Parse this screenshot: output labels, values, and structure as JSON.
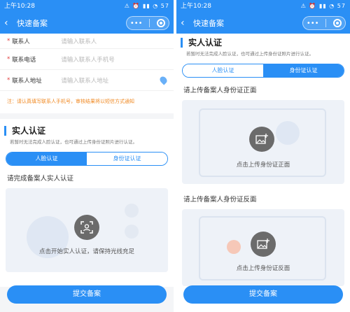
{
  "status": {
    "time": "上午10:28",
    "icons": "⚠ ⏰ ▮▮ ◔ 57"
  },
  "header": {
    "title": "快速备案",
    "capsule_dots": "•••"
  },
  "left": {
    "fields": [
      {
        "label": "联系人",
        "placeholder": "请输入联系人"
      },
      {
        "label": "联系电话",
        "placeholder": "请输入联系人手机号"
      },
      {
        "label": "联系人地址",
        "placeholder": "请输入联系人地址"
      }
    ],
    "notice": "注：请认真填写联系人手机号，审核结果将以短信方式通知",
    "section_title": "实人认证",
    "section_sub": "若暂时无法完成人脸认证，也可通过上传身份证照片进行认证。",
    "tabs": [
      "人脸认证",
      "身份证认证"
    ],
    "prompt": "请完成备案人实人认证",
    "upload_text": "点击开始实人认证，请保持光线充足",
    "submit": "提交备案"
  },
  "right": {
    "section_title": "实人认证",
    "section_sub": "若暂时无法完成人脸认证，也可通过上传身份证照片进行认证。",
    "tabs": [
      "人脸认证",
      "身份证认证"
    ],
    "front_title": "请上传备案人身份证正面",
    "front_text": "点击上传身份证正面",
    "back_title": "请上传备案人身份证反面",
    "back_text": "点击上传身份证反面",
    "submit": "提交备案"
  }
}
